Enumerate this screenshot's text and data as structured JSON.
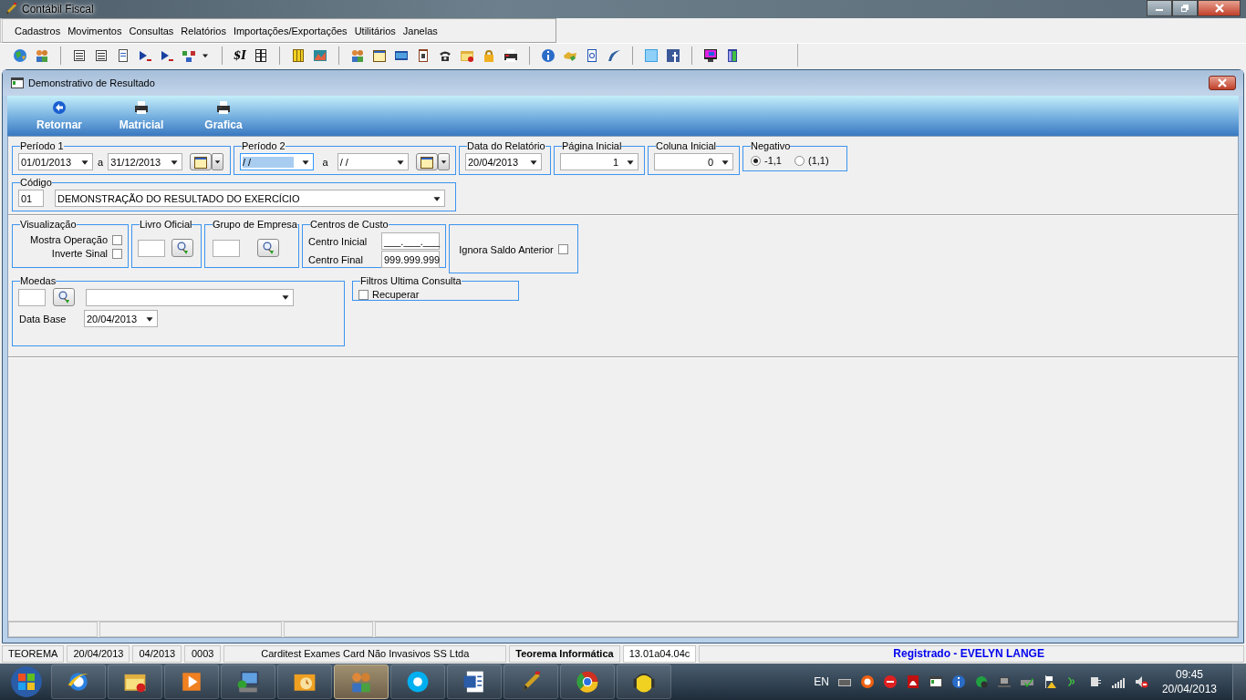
{
  "app": {
    "title": "Contábil Fiscal"
  },
  "menu": [
    "Cadastros",
    "Movimentos",
    "Consultas",
    "Relatórios",
    "Importações/Exportações",
    "Utilitários",
    "Janelas"
  ],
  "toolbar_text": "$I",
  "window": {
    "title": "Demonstrativo de Resultado"
  },
  "actions": [
    {
      "label": "Retornar",
      "kind": "back"
    },
    {
      "label": "Matricial",
      "kind": "print"
    },
    {
      "label": "Grafica",
      "kind": "print"
    }
  ],
  "periodo1": {
    "label": "Período 1",
    "from": "01/01/2013",
    "sep": "a",
    "to": "31/12/2013"
  },
  "periodo2": {
    "label": "Período 2",
    "from": "/ /",
    "sep": "a",
    "to": "/ /",
    "focused": true
  },
  "data_relatorio": {
    "label": "Data do Relatório",
    "value": "20/04/2013"
  },
  "pagina_inicial": {
    "label": "Página Inicial",
    "value": "1"
  },
  "coluna_inicial": {
    "label": "Coluna Inicial",
    "value": "0"
  },
  "negativo": {
    "label": "Negativo",
    "options": [
      {
        "label": "-1,1",
        "selected": true
      },
      {
        "label": "(1,1)",
        "selected": false
      }
    ]
  },
  "codigo": {
    "label": "Código",
    "code": "01",
    "value": "DEMONSTRAÇÃO DO RESULTADO DO EXERCÍCIO"
  },
  "visualizacao": {
    "label": "Visualização",
    "options": [
      {
        "label": "Mostra Operação",
        "checked": false
      },
      {
        "label": "Inverte Sinal",
        "checked": false
      }
    ]
  },
  "livro_oficial": {
    "label": "Livro Oficial"
  },
  "grupo_empresa": {
    "label": "Grupo de Empresa"
  },
  "centros_custo": {
    "label": "Centros de Custo",
    "fields": [
      {
        "label": "Centro Inicial",
        "value": "___.___.___"
      },
      {
        "label": "Centro Final",
        "value": "999.999.999"
      }
    ]
  },
  "ignora_saldo": {
    "label": "Ignora Saldo Anterior",
    "checked": false
  },
  "moedas": {
    "label": "Moedas",
    "data_base_label": "Data Base",
    "data_base": "20/04/2013"
  },
  "filtros": {
    "label": "Filtros Ultima Consulta",
    "option": {
      "label": "Recuperar",
      "checked": false
    }
  },
  "status_bar": [
    {
      "text": "TEOREMA",
      "kind": "plain"
    },
    {
      "text": "20/04/2013",
      "kind": "plain"
    },
    {
      "text": "04/2013",
      "kind": "plain"
    },
    {
      "text": "0003",
      "kind": "plain"
    },
    {
      "text": "Carditest Exames Card Não Invasivos SS Ltda",
      "kind": "wide"
    },
    {
      "text": "Teorema Informática",
      "kind": "bold"
    },
    {
      "text": "13.01a04.04c",
      "kind": "version"
    },
    {
      "text": "Registrado - EVELYN LANGE",
      "kind": "registered"
    }
  ],
  "taskbar": {
    "apps": [
      {
        "kind": "browser",
        "selected": false
      },
      {
        "kind": "folder",
        "selected": false
      },
      {
        "kind": "media",
        "selected": false
      },
      {
        "kind": "computer",
        "selected": false
      },
      {
        "kind": "mail",
        "selected": false
      },
      {
        "kind": "people",
        "selected": true
      },
      {
        "kind": "chat",
        "selected": false
      },
      {
        "kind": "document",
        "selected": false
      },
      {
        "kind": "pencil",
        "selected": false
      },
      {
        "kind": "wheel",
        "selected": false
      },
      {
        "kind": "smiley",
        "selected": false
      }
    ],
    "language": "EN",
    "time": "09:45",
    "date": "20/04/2013"
  }
}
